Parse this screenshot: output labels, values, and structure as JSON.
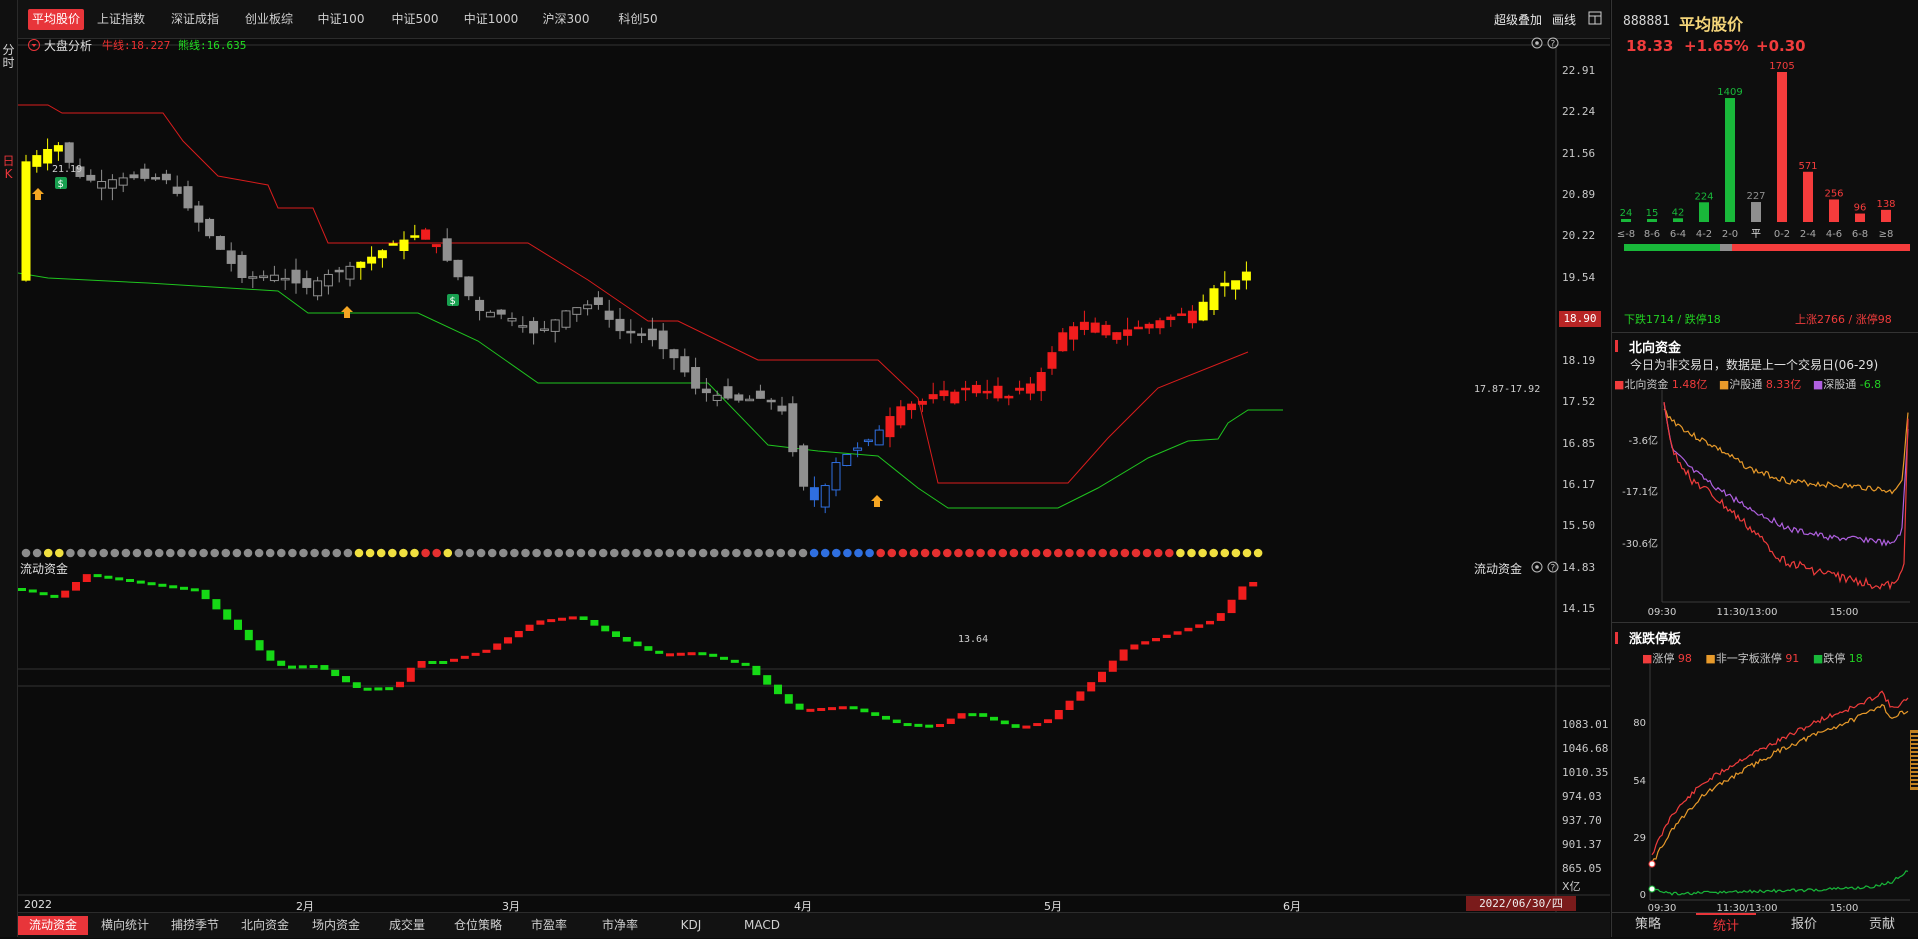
{
  "left_strip": {
    "minute_label": "分时",
    "day_label": "日K"
  },
  "top_tabs": [
    "平均股价",
    "上证指数",
    "深证成指",
    "创业板综",
    "中证100",
    "中证500",
    "中证1000",
    "沪深300",
    "科创50"
  ],
  "top_right": {
    "overlay": "超级叠加",
    "draw": "画线"
  },
  "main_chart": {
    "title": "大盘分析",
    "bull_line": "牛线:18.227",
    "bear_line": "熊线:16.635",
    "price_axis": [
      "22.91",
      "22.24",
      "21.56",
      "20.89",
      "20.22",
      "19.54",
      "18.19",
      "17.52",
      "16.85",
      "16.17",
      "15.50",
      "14.83",
      "14.15"
    ],
    "current_price_tag": "18.90",
    "label_high": "21.19",
    "label_low": "13.64",
    "label_range": "17.87-17.92"
  },
  "flow_chart": {
    "title": "流动资金",
    "title_right": "流动资金",
    "axis": [
      "1083.01",
      "1046.68",
      "1010.35",
      "974.03",
      "937.70",
      "901.37",
      "865.05"
    ],
    "unit": "X亿"
  },
  "date_axis": [
    "2022",
    "2月",
    "3月",
    "4月",
    "5月",
    "6月"
  ],
  "date_label": "2022/06/30/四",
  "bottom_tabs": [
    "流动资金",
    "横向统计",
    "捕捞季节",
    "北向资金",
    "场内资金",
    "成交量",
    "仓位策略",
    "市盈率",
    "市净率",
    "KDJ",
    "MACD"
  ],
  "right_panel": {
    "code": "888881",
    "name": "平均股价",
    "price": "18.33",
    "pct": "+1.65%",
    "change": "+0.30",
    "distribution": {
      "labels": [
        "≤-8",
        "8-6",
        "6-4",
        "4-2",
        "2-0",
        "平",
        "0-2",
        "2-4",
        "4-6",
        "6-8",
        "≥8"
      ],
      "values": [
        24,
        15,
        42,
        224,
        1409,
        227,
        1705,
        571,
        256,
        96,
        138
      ],
      "value_labels": [
        "24",
        "15",
        "42",
        "224",
        "1409",
        "227",
        "1705",
        "571",
        "256",
        "96",
        "138"
      ],
      "colors": [
        "#19b83a",
        "#19b83a",
        "#19b83a",
        "#19b83a",
        "#19b83a",
        "#8f8f8f",
        "#f53c3c",
        "#f53c3c",
        "#f53c3c",
        "#f53c3c",
        "#f53c3c"
      ],
      "down_text": "下跌1714 / 跌停18",
      "up_text": "上涨2766 / 涨停98"
    },
    "northbound": {
      "title": "北向资金",
      "note": "今日为非交易日，数据是上一个交易日(06-29)",
      "legend": [
        {
          "label": "北向资金",
          "value": "1.48亿",
          "color": "#f03c3c"
        },
        {
          "label": "沪股通",
          "value": "8.33亿",
          "color": "#e89a2a"
        },
        {
          "label": "深股通",
          "value": "-6.8",
          "color": "#b060e0"
        }
      ],
      "yaxis": [
        "-3.6亿",
        "-17.1亿",
        "-30.6亿"
      ],
      "xaxis": [
        "09:30",
        "11:30/13:00",
        "15:00"
      ]
    },
    "limit": {
      "title": "涨跌停板",
      "legend": [
        {
          "label": "涨停",
          "value": "98",
          "color": "#f03c3c"
        },
        {
          "label": "非一字板涨停",
          "value": "91",
          "color": "#e89a2a"
        },
        {
          "label": "跌停",
          "value": "18",
          "color": "#19b83a"
        }
      ],
      "yaxis": [
        "80",
        "54",
        "29",
        "0"
      ],
      "xaxis": [
        "09:30",
        "11:30/13:00",
        "15:00"
      ]
    },
    "tabs": [
      "策略",
      "统计",
      "报价",
      "贡献"
    ]
  },
  "colors": {
    "up": "#f01d1d",
    "down": "#16d916",
    "accent": "#e8353a",
    "yellow": "#ffff00",
    "blue": "#2f6fe0",
    "gray_candle": "#909090"
  }
}
